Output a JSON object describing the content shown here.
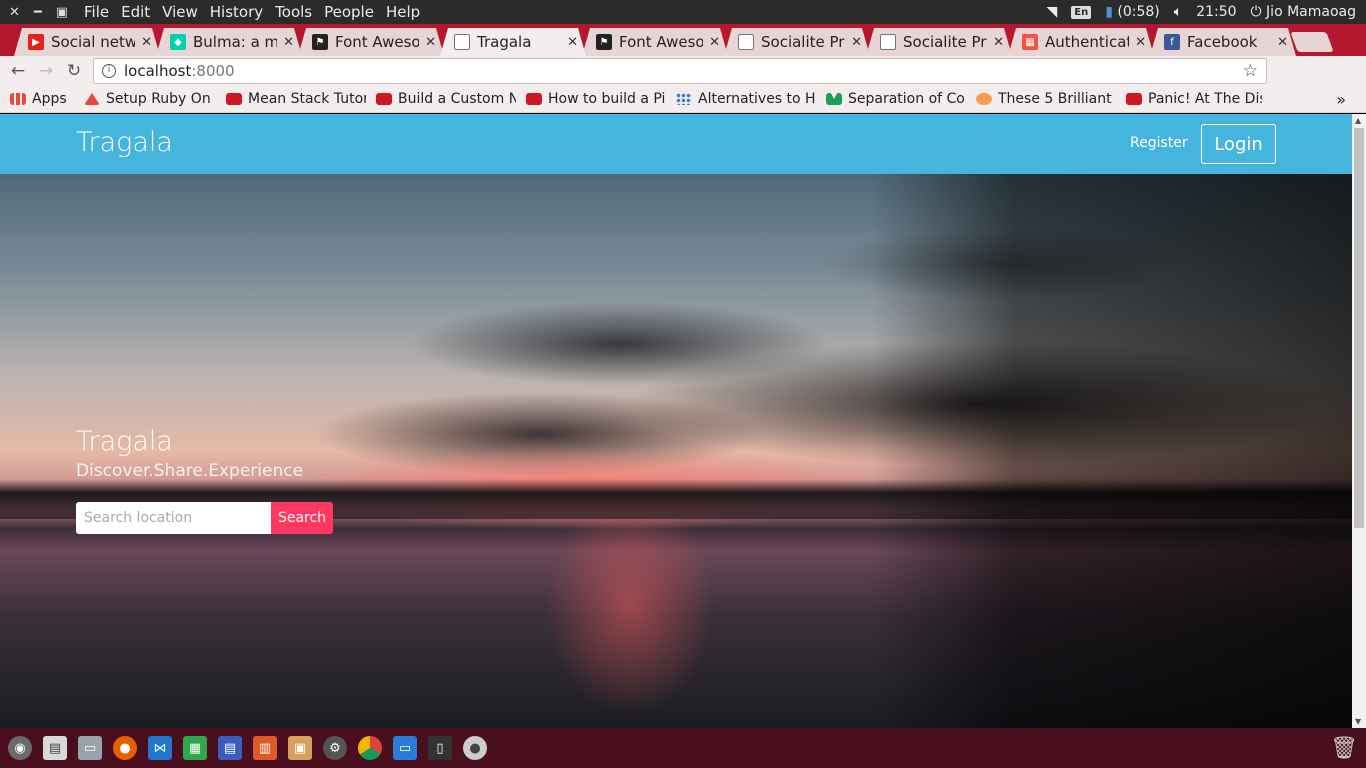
{
  "top_panel": {
    "menu": [
      "File",
      "Edit",
      "View",
      "History",
      "Tools",
      "People",
      "Help"
    ],
    "keyboard": "En",
    "battery": "(0:58)",
    "time": "21:50",
    "user": "Jio Mamaoag"
  },
  "tabs": [
    {
      "title": "Social netw",
      "fav_color": "#e62117"
    },
    {
      "title": "Bulma: a mo",
      "fav_color": "#00d1b2"
    },
    {
      "title": "Font Aweso",
      "fav_color": "#222222"
    },
    {
      "title": "Tragala",
      "fav_color": "#ffffff"
    },
    {
      "title": "Font Aweso",
      "fav_color": "#222222"
    },
    {
      "title": "Socialite Pro",
      "fav_color": "#ffffff"
    },
    {
      "title": "Socialite Pro",
      "fav_color": "#ffffff"
    },
    {
      "title": "Authenticati",
      "fav_color": "#f05340"
    },
    {
      "title": "Facebook",
      "fav_color": "#3b5998"
    }
  ],
  "address_bar": {
    "host": "localhost",
    "port": ":8000"
  },
  "bookmarks": [
    {
      "label": "Apps",
      "color": "#e14b3b"
    },
    {
      "label": "Setup Ruby On R",
      "color": "#e14b3b"
    },
    {
      "label": "Mean Stack Tutor",
      "color": "#cc181e"
    },
    {
      "label": "Build a Custom N",
      "color": "#cc181e"
    },
    {
      "label": "How to build a Pi",
      "color": "#cc181e"
    },
    {
      "label": "Alternatives to H",
      "color": "#3d79d1"
    },
    {
      "label": "Separation of Co",
      "color": "#1a9f5e"
    },
    {
      "label": "These 5 Brilliant",
      "color": "#f39c52"
    },
    {
      "label": "Panic! At The Dis",
      "color": "#cc181e"
    }
  ],
  "site": {
    "brand": "Tragala",
    "register": "Register",
    "login": "Login",
    "hero_title": "Tragala",
    "hero_subtitle": "Discover.Share.Experience",
    "search_placeholder": "Search location",
    "search_button": "Search"
  },
  "launcher_icons": [
    "ubuntu-icon",
    "notes-icon",
    "files-icon",
    "firefox-icon",
    "vscode-icon",
    "spreadsheet-icon",
    "document-icon",
    "presentation-icon",
    "software-center-icon",
    "settings-icon",
    "chrome-icon",
    "remmina-icon",
    "phone-icon",
    "disc-icon"
  ]
}
